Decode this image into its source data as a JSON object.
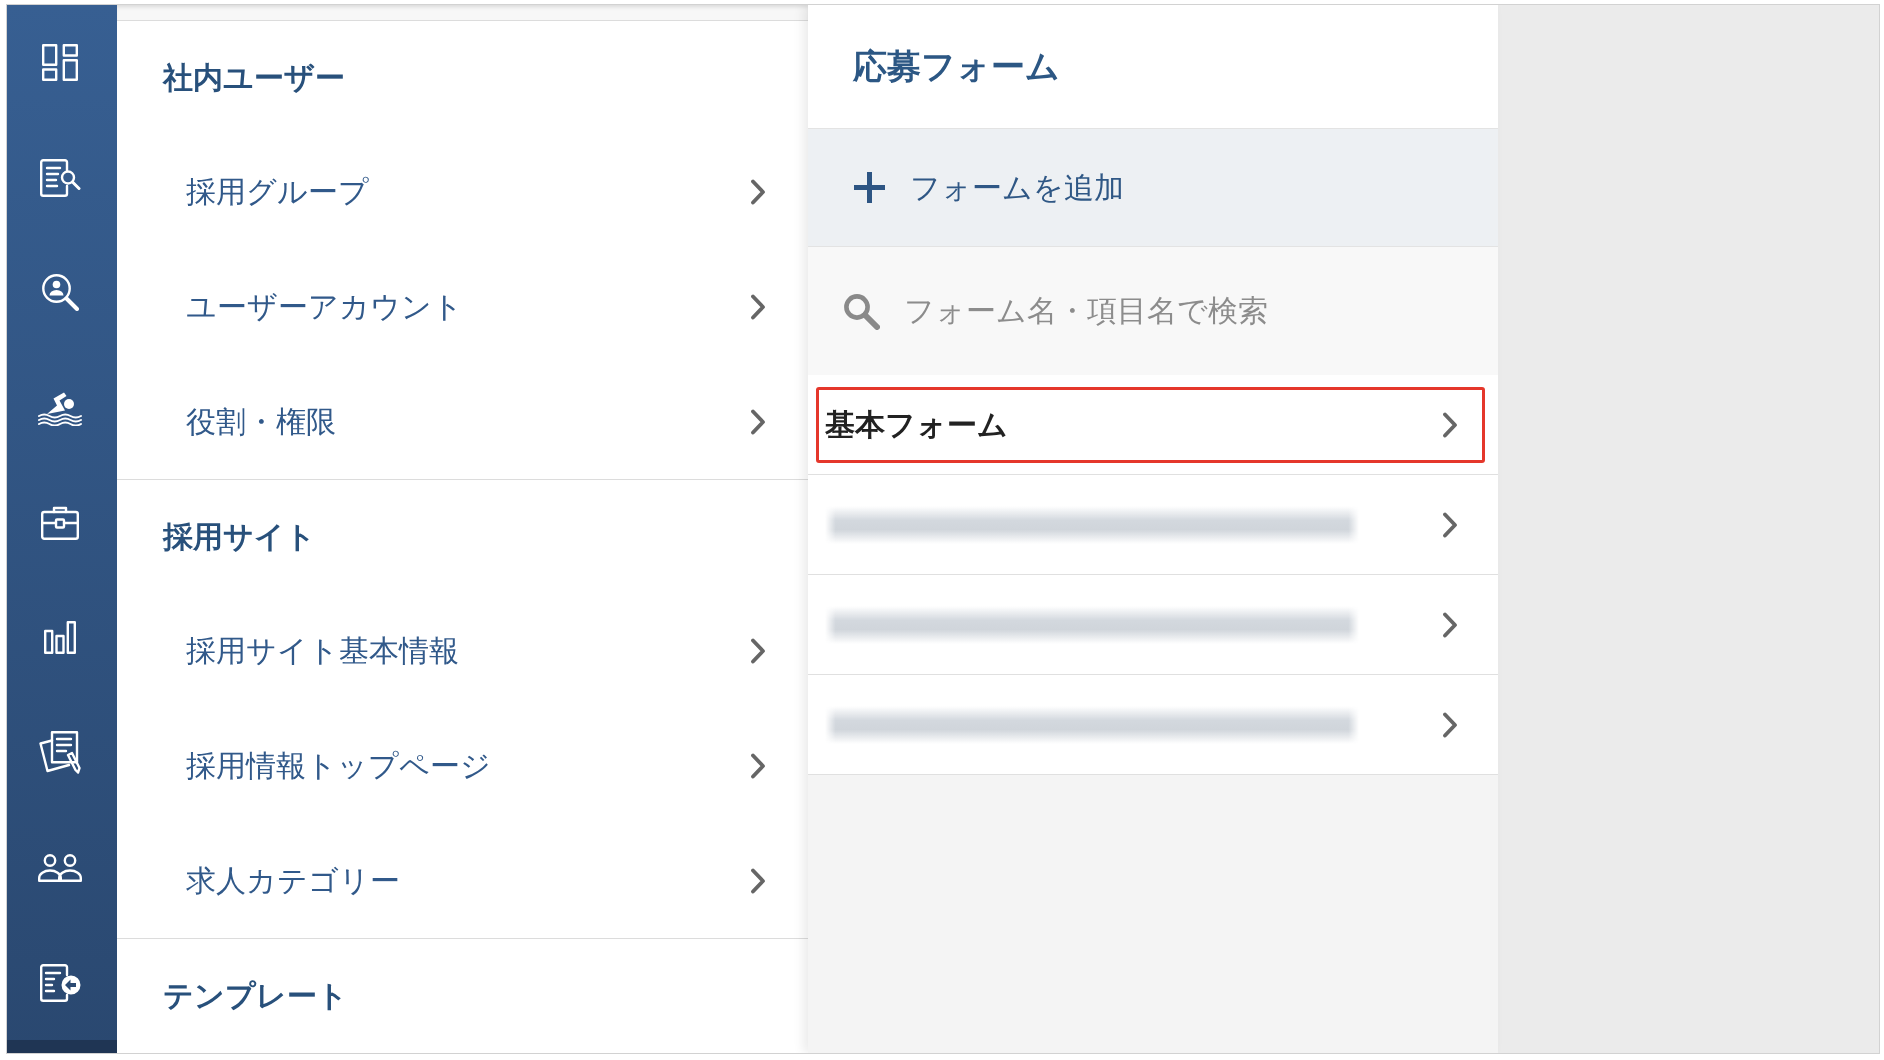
{
  "settings_menu": {
    "sections": [
      {
        "title": "社内ユーザー",
        "items": [
          {
            "label": "採用グループ"
          },
          {
            "label": "ユーザーアカウント"
          },
          {
            "label": "役割・権限"
          }
        ]
      },
      {
        "title": "採用サイト",
        "items": [
          {
            "label": "採用サイト基本情報"
          },
          {
            "label": "採用情報トップページ"
          },
          {
            "label": "求人カテゴリー"
          }
        ]
      },
      {
        "title": "テンプレート"
      }
    ]
  },
  "form_panel": {
    "title": "応募フォーム",
    "add_button": {
      "label": "フォームを追加"
    },
    "search": {
      "placeholder": "フォーム名・項目名で検索"
    },
    "forms": [
      {
        "kind": "named",
        "label": "基本フォーム",
        "highlighted": true
      },
      {
        "kind": "blurred",
        "highlighted": false
      },
      {
        "kind": "blurred",
        "highlighted": false
      },
      {
        "kind": "blurred",
        "highlighted": false
      }
    ]
  }
}
